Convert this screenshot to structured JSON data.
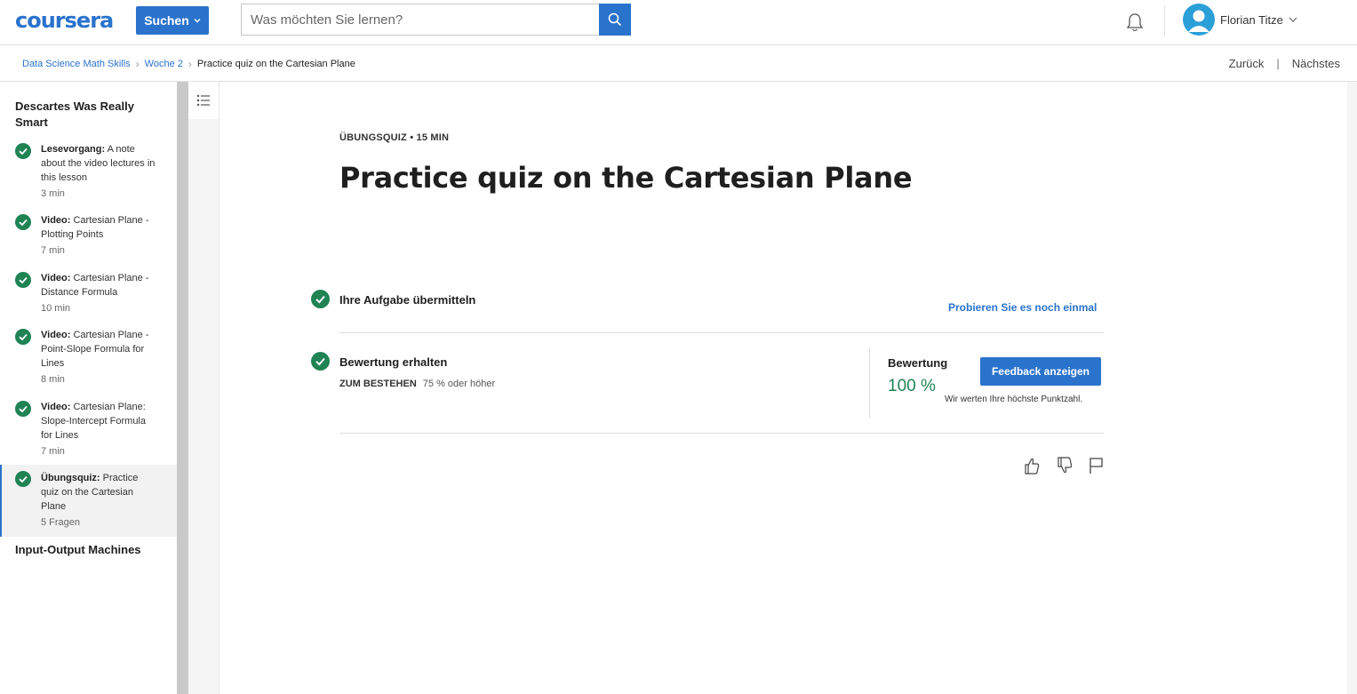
{
  "header": {
    "logo": "coursera",
    "search_button": "Suchen",
    "search_placeholder": "Was möchten Sie lernen?",
    "user_name": "Florian Titze"
  },
  "breadcrumb": {
    "items": [
      "Data Science Math Skills",
      "Woche 2"
    ],
    "current": "Practice quiz on the Cartesian Plane"
  },
  "nav": {
    "prev": "Zurück",
    "separator": "|",
    "next": "Nächstes"
  },
  "sidebar": {
    "lesson_title": "Descartes Was Really Smart",
    "items": [
      {
        "type": "Lesevorgang:",
        "title": " A note about the video lectures in this lesson",
        "meta": "3 min"
      },
      {
        "type": "Video:",
        "title": " Cartesian Plane - Plotting Points",
        "meta": "7 min"
      },
      {
        "type": "Video:",
        "title": " Cartesian Plane - Distance Formula",
        "meta": "10 min"
      },
      {
        "type": "Video:",
        "title": " Cartesian Plane - Point-Slope Formula for Lines",
        "meta": "8 min"
      },
      {
        "type": "Video:",
        "title": " Cartesian Plane: Slope-Intercept Formula for Lines",
        "meta": "7 min"
      },
      {
        "type": "Übungsquiz:",
        "title": " Practice quiz on the Cartesian Plane",
        "meta": "5 Fragen"
      }
    ],
    "next_lesson": "Input-Output Machines"
  },
  "main": {
    "eyebrow": "ÜBUNGSQUIZ • 15 MIN",
    "title": "Practice quiz on the Cartesian Plane",
    "step1": {
      "title": "Ihre Aufgabe übermitteln",
      "retry": "Probieren Sie es noch einmal"
    },
    "step2": {
      "title": "Bewertung erhalten",
      "pass_label": "ZUM BESTEHEN",
      "pass_value": "75 % oder höher",
      "grade_label": "Bewertung",
      "grade_value": "100 %",
      "feedback_button": "Feedback anzeigen",
      "grade_note": "Wir werten Ihre höchste Punktzahl."
    }
  },
  "colors": {
    "brand": "#2a73cc",
    "success": "#1f8354"
  }
}
